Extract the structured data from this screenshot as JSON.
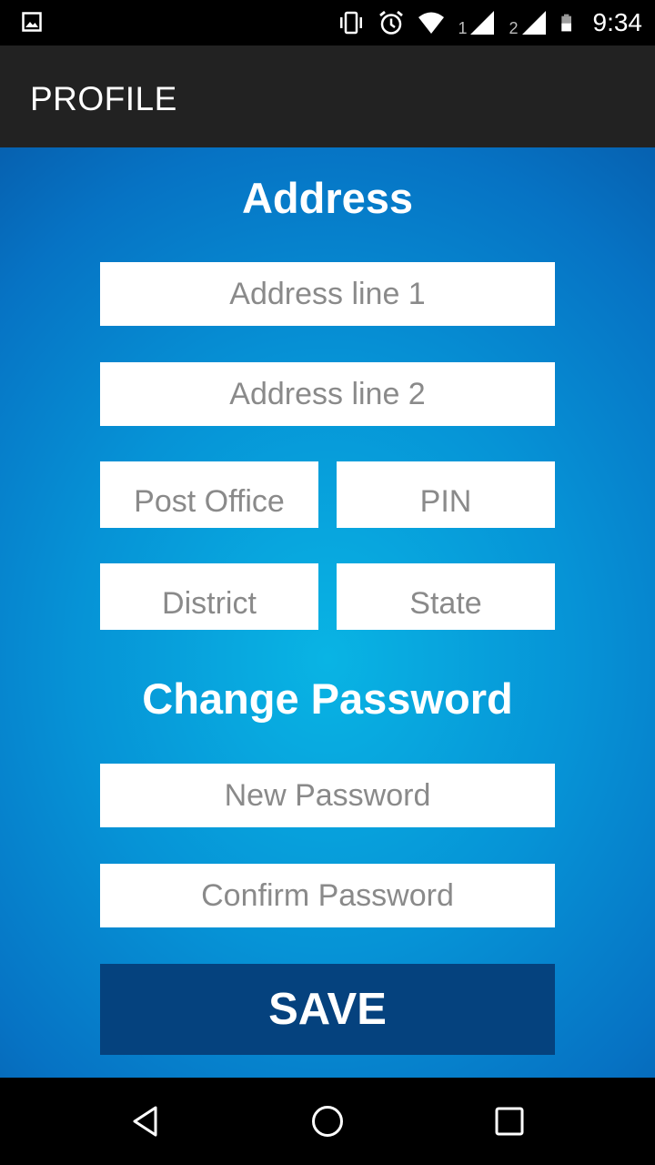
{
  "status_bar": {
    "time": "9:34",
    "sim1_label": "1",
    "sim2_label": "2",
    "icons": [
      "gallery-icon",
      "vibrate-icon",
      "alarm-icon",
      "wifi-icon",
      "signal-icon",
      "battery-icon"
    ]
  },
  "app_bar": {
    "title": "PROFILE"
  },
  "address_section": {
    "title": "Address",
    "address_line_1_placeholder": "Address line 1",
    "address_line_2_placeholder": "Address line 2",
    "post_office_placeholder": "Post Office",
    "pin_placeholder": "PIN",
    "district_placeholder": "District",
    "state_placeholder": "State"
  },
  "password_section": {
    "title": "Change Password",
    "new_password_placeholder": "New Password",
    "confirm_password_placeholder": "Confirm Password"
  },
  "save_button": {
    "label": "SAVE"
  },
  "nav_bar": {
    "icons": [
      "back-icon",
      "home-icon",
      "recent-apps-icon"
    ]
  },
  "colors": {
    "app_bar_bg": "#222222",
    "content_bg_center": "#09b4e4",
    "content_bg_edge": "#065fae",
    "save_button_bg": "#05427e",
    "placeholder_text": "#8a8a8a"
  }
}
